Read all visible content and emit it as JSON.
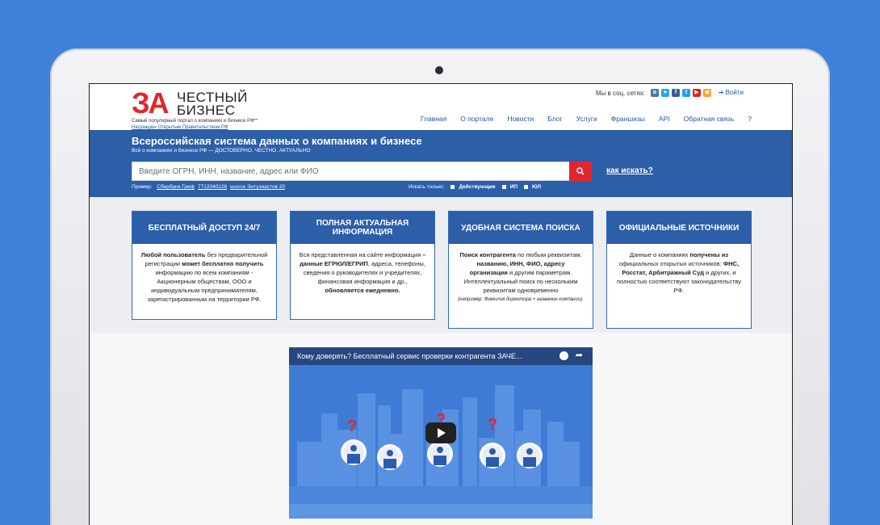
{
  "header": {
    "logo_za": "ЗА",
    "logo_word_1": "ЧЕСТНЫЙ",
    "logo_word_2": "БИЗНЕС",
    "tagline": "Самый популярный портал о компаниях и бизнесе РФ**",
    "award": "Награжден Открытым Правительством РФ",
    "social_label": "Мы в соц. сетях:",
    "social_icons": [
      {
        "name": "vk-icon",
        "glyph": "в",
        "color": "#4a76a8"
      },
      {
        "name": "telegram-icon",
        "glyph": "➤",
        "color": "#2ca5e0"
      },
      {
        "name": "facebook-icon",
        "glyph": "f",
        "color": "#3b5998"
      },
      {
        "name": "twitter-icon",
        "glyph": "t",
        "color": "#1da1f2"
      },
      {
        "name": "youtube-icon",
        "glyph": "▶",
        "color": "#e62117"
      },
      {
        "name": "rss-icon",
        "glyph": "◉",
        "color": "#f7a531"
      }
    ],
    "login_label": "Войти",
    "nav": [
      "Главная",
      "О портале",
      "Новости",
      "Блог",
      "Услуги",
      "Франшизы",
      "API",
      "Обратная связь",
      "?"
    ]
  },
  "search": {
    "title": "Всероссийская система данных о компаниях и бизнесе",
    "subtitle": "Всё о компаниях и бизнесе РФ — ДОСТОВЕРНО, ЧЕСТНО, АКТУАЛЬНО",
    "placeholder": "Введите ОГРН, ИНН, название, адрес или ФИО",
    "howto": "как искать?",
    "example_label": "Пример:",
    "examples": [
      "Сбербанк Греф",
      "7712040126",
      "шоссе Энтузиастов 20"
    ],
    "filter_label": "Искать только:",
    "filters": [
      "Действующие",
      "ИП",
      "ЮЛ"
    ]
  },
  "cards": [
    {
      "title": "БЕСПЛАТНЫЙ ДОСТУП 24/7",
      "parts": [
        [
          "b",
          "Любой пользователь"
        ],
        [
          "t",
          " без предварительной регистрации "
        ],
        [
          "b",
          "может бесплатно получить"
        ],
        [
          "t",
          " информацию по всем компаниям - Акционерным обществам, ООО и индивидуальным предпринимателям, зарегистрированным на территории РФ."
        ]
      ]
    },
    {
      "title": "ПОЛНАЯ АКТУАЛЬНАЯ ИНФОРМАЦИЯ",
      "parts": [
        [
          "t",
          "Вся представленная на сайте информация "
        ],
        [
          "b",
          "– данные ЕГРЮЛ/ЕГРИП"
        ],
        [
          "t",
          ", адреса, телефоны, сведения о руководителях и учредителях, финансовая информация и др., "
        ],
        [
          "b",
          "обновляется ежедневно."
        ]
      ]
    },
    {
      "title": "УДОБНАЯ СИСТЕМА ПОИСКА",
      "parts": [
        [
          "b",
          "Поиск контрагента"
        ],
        [
          "t",
          " по любым реквизитам: "
        ],
        [
          "b",
          "названию, ИНН, ФИО, адресу организации"
        ],
        [
          "t",
          " и другим параметрам. Интеллектуальный поиск по нескольким реквизитам одновременно"
        ]
      ],
      "note": "(например: Фамилия директора + название компании)."
    },
    {
      "title": "ОФИЦИАЛЬНЫЕ ИСТОЧНИКИ",
      "parts": [
        [
          "t",
          "Данные о компаниях "
        ],
        [
          "b",
          "получены из"
        ],
        [
          "t",
          " официальных открытых источников: "
        ],
        [
          "b",
          "ФНС, Росстат, Арбитражный Суд"
        ],
        [
          "t",
          " и других, и полностью соответствуют законодательству РФ."
        ]
      ]
    }
  ],
  "video": {
    "title": "Кому доверять? Бесплатный сервис проверки контрагента ЗАЧЕ..."
  }
}
